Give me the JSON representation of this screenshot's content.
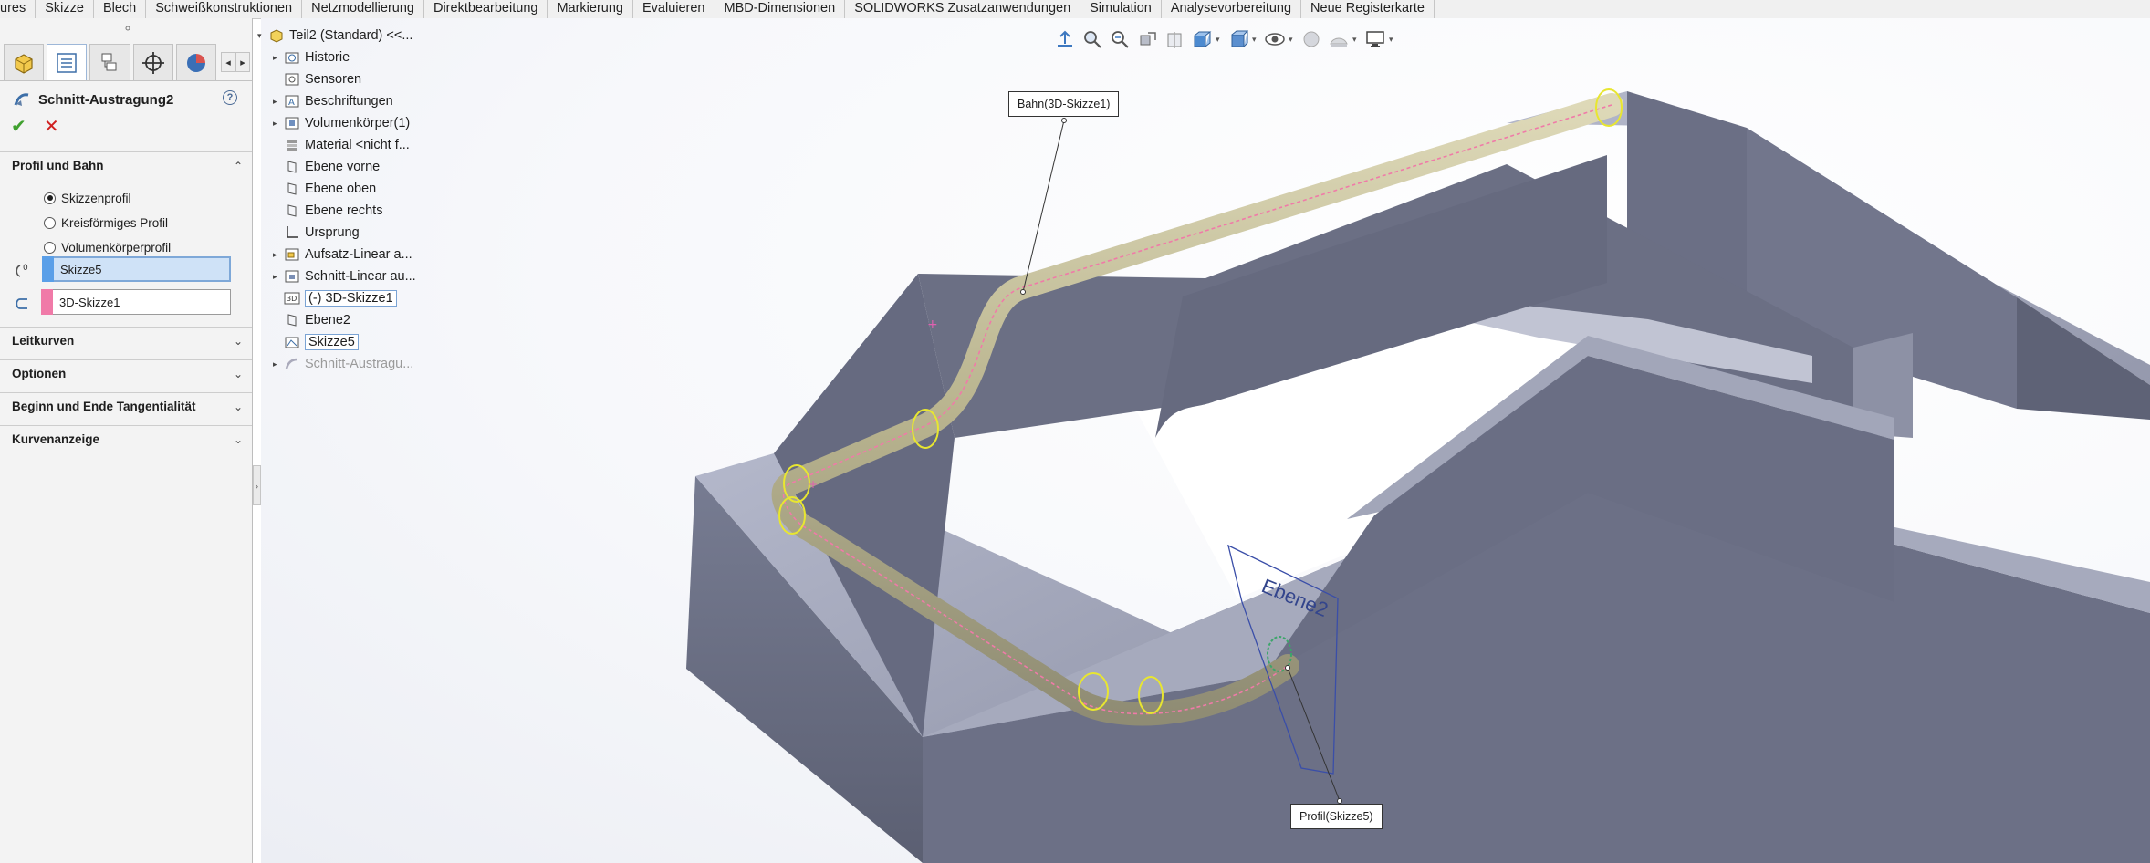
{
  "ribbon": {
    "tabs": [
      "ures",
      "Skizze",
      "Blech",
      "Schweißkonstruktionen",
      "Netzmodellierung",
      "Direktbearbeitung",
      "Markierung",
      "Evaluieren",
      "MBD-Dimensionen",
      "SOLIDWORKS Zusatzanwendungen",
      "Simulation",
      "Analysevorbereitung",
      "Neue Registerkarte"
    ]
  },
  "property_manager": {
    "title": "Schnitt-Austragung2",
    "help": "?",
    "ok": "✔",
    "cancel": "✕",
    "section_profile": "Profil und Bahn",
    "profile_options": [
      "Skizzenprofil",
      "Kreisförmiges Profil",
      "Volumenkörperprofil"
    ],
    "selected_option": "Skizzenprofil",
    "profile_box": "Skizze5",
    "path_box": "3D-Skizze1",
    "profile_color": "#5a9fe8",
    "path_color": "#f07aa8",
    "sections": [
      "Leitkurven",
      "Optionen",
      "Beginn und Ende Tangentialität",
      "Kurvenanzeige"
    ],
    "chevron_up": "⌃",
    "chevron_down": "⌄"
  },
  "tree": {
    "root": "Teil2  (Standard) <<...",
    "items": [
      {
        "label": "Historie",
        "icon": "history-folder-icon"
      },
      {
        "label": "Sensoren",
        "icon": "sensor-icon"
      },
      {
        "label": "Beschriftungen",
        "icon": "annotation-icon"
      },
      {
        "label": "Volumenkörper(1)",
        "icon": "solid-bodies-icon"
      },
      {
        "label": "Material <nicht f...",
        "icon": "material-icon"
      },
      {
        "label": "Ebene vorne",
        "icon": "plane-icon"
      },
      {
        "label": "Ebene oben",
        "icon": "plane-icon"
      },
      {
        "label": "Ebene rechts",
        "icon": "plane-icon"
      },
      {
        "label": "Ursprung",
        "icon": "origin-icon"
      },
      {
        "label": "Aufsatz-Linear a...",
        "icon": "extrude-boss-icon"
      },
      {
        "label": "Schnitt-Linear au...",
        "icon": "extrude-cut-icon"
      },
      {
        "label": "(-) 3D-Skizze1",
        "icon": "sketch3d-icon"
      },
      {
        "label": "Ebene2",
        "icon": "plane-icon"
      },
      {
        "label": "Skizze5",
        "icon": "sketch-icon"
      },
      {
        "label": "Schnitt-Austragu...",
        "icon": "swept-cut-icon"
      }
    ]
  },
  "viewport": {
    "callout_path": "Bahn(3D-Skizze1)",
    "callout_profile": "Profil(Skizze5)",
    "plane_label": "Ebene2",
    "face_color": "#5f6478",
    "top_color": "#a3a7bb",
    "sweep_color": "#c9c29a"
  }
}
